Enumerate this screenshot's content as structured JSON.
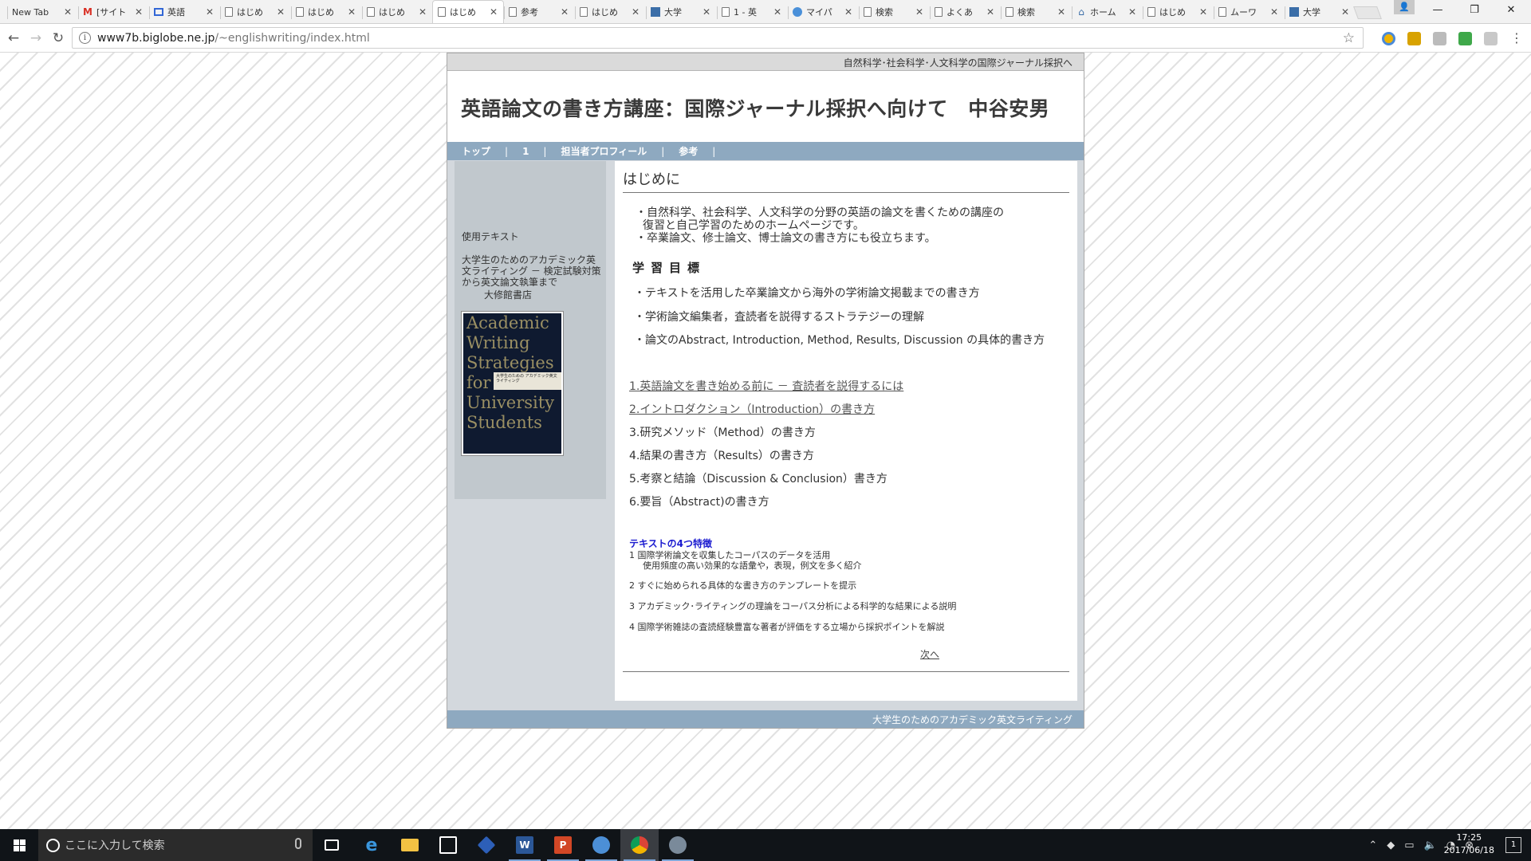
{
  "browser": {
    "tabs": [
      {
        "title": "New Tab",
        "icon": "none"
      },
      {
        "title": "[サイト",
        "icon": "gmail-icon"
      },
      {
        "title": "英語",
        "icon": "window-icon"
      },
      {
        "title": "はじめ",
        "icon": "doc-icon"
      },
      {
        "title": "はじめ",
        "icon": "doc-icon"
      },
      {
        "title": "はじめ",
        "icon": "doc-icon"
      },
      {
        "title": "はじめ",
        "icon": "doc-icon",
        "active": true
      },
      {
        "title": "参考",
        "icon": "doc-icon"
      },
      {
        "title": "はじめ",
        "icon": "doc-icon"
      },
      {
        "title": "大学",
        "icon": "book-icon"
      },
      {
        "title": "1 - 英",
        "icon": "doc-icon"
      },
      {
        "title": "マイパ",
        "icon": "globe-icon"
      },
      {
        "title": "検索",
        "icon": "doc-icon"
      },
      {
        "title": "よくあ",
        "icon": "doc-icon"
      },
      {
        "title": "検索",
        "icon": "doc-icon"
      },
      {
        "title": "ホーム",
        "icon": "home-icon"
      },
      {
        "title": "はじめ",
        "icon": "doc-icon"
      },
      {
        "title": "ムーワ",
        "icon": "doc-icon"
      },
      {
        "title": "大学",
        "icon": "book-icon"
      }
    ],
    "url_host": "www7b.biglobe.ne.jp",
    "url_path": "/~englishwriting/index.html"
  },
  "site": {
    "topbar_text": "自然科学･社会科学･人文科学の国際ジャーナル採択へ",
    "header_title": "英語論文の書き方講座：国際ジャーナル採択へ向けて　中谷安男",
    "nav": [
      "トップ",
      "1",
      "担当者プロフィール",
      "参考"
    ],
    "sidebar": {
      "caption": "使用テキスト",
      "book_text": "大学生のためのアカデミック英文ライティング － 検定試験対策から英文論文執筆まで",
      "publisher": "大修館書店",
      "cover_title_lines": [
        "Academic",
        "Writing",
        "Strategies",
        "for",
        "University",
        "Students"
      ],
      "cover_band": "大学生のための アカデミック英文ライティング"
    },
    "main": {
      "heading": "はじめに",
      "intro": [
        "・自然科学、社会科学、人文科学の分野の英語の論文を書くための講座の",
        "復習と自己学習のためのホームページです。",
        "・卒業論文、修士論文、博士論文の書き方にも役立ちます。"
      ],
      "goals_title": "学習目標",
      "goals": [
        "・テキストを活用した卒業論文から海外の学術論文掲載までの書き方",
        "・学術論文編集者，査読者を説得するストラテジーの理解",
        "・論文のAbstract, Introduction, Method, Results,  Discussion の具体的書き方"
      ],
      "chapters": [
        "1.英語論文を書き始める前に － 査読者を説得するには",
        "2.イントロダクション（Introduction）の書き方",
        "3.研究メソッド（Method）の書き方",
        "4.結果の書き方（Results）の書き方",
        "5.考察と結論（Discussion & Conclusion）書き方",
        "6.要旨（Abstract)の書き方"
      ],
      "features_title": "テキストの4つ特徴",
      "features": [
        "1  国際学術論文を収集したコーパスのデータを活用",
        "使用頻度の高い効果的な語彙や，表現，例文を多く紹介",
        "2  すぐに始められる具体的な書き方のテンプレートを提示",
        "3  アカデミック･ライティングの理論をコーパス分析による科学的な結果による説明",
        "4  国際学術雑誌の査読経験豊富な著者が評価をする立場から採択ポイントを解説"
      ],
      "next_link": "次へ"
    },
    "footer_text": "大学生のためのアカデミック英文ライティング"
  },
  "taskbar": {
    "search_placeholder": "ここに入力して検索",
    "clock_time": "17:25",
    "clock_date": "2017/06/18",
    "notification_count": "1"
  }
}
